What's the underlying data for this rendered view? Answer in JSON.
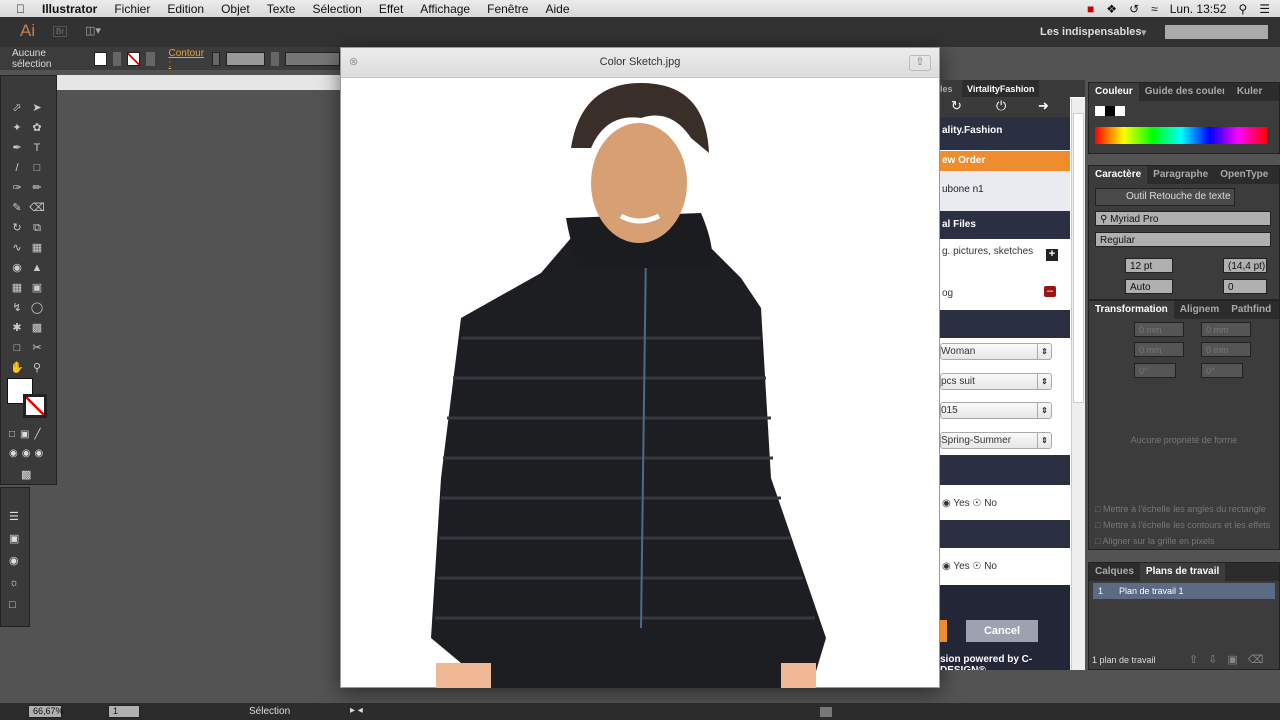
{
  "menubar": {
    "app": "Illustrator",
    "items": [
      "Fichier",
      "Edition",
      "Objet",
      "Texte",
      "Sélection",
      "Effet",
      "Affichage",
      "Fenêtre",
      "Aide"
    ],
    "clock": "Lun. 13:52"
  },
  "appbar": {
    "logo": "Ai",
    "bridge": "Br",
    "workspace": "Les indispensables",
    "search_placeholder": ""
  },
  "control": {
    "selection": "Aucune sélection",
    "stroke_label": "Contour :"
  },
  "quicklook": {
    "title": "Color Sketch.jpg"
  },
  "extension": {
    "tabs": [
      "les",
      "VirtalityFashion"
    ],
    "brand": "ality.Fashion",
    "new_order": "ew Order",
    "product": "ubone n1",
    "files_header": "al Files",
    "files_hint": "g. pictures, sketches",
    "file_name": "og",
    "selects": [
      "Woman",
      "pcs suit",
      "015",
      "Spring-Summer"
    ],
    "yes": "Yes",
    "no": "No",
    "cancel": "Cancel",
    "footer": "sion powered by C-DESIGN®."
  },
  "color_panel": {
    "tabs": [
      "Couleur",
      "Guide des couleı",
      "Kuler"
    ]
  },
  "char_panel": {
    "tabs": [
      "Caractère",
      "Paragraphe",
      "OpenType"
    ],
    "touch_tool": "Outil Retouche de texte",
    "font": "Myriad Pro",
    "style": "Regular",
    "size": "12 pt",
    "leading": "(14,4 pt)",
    "kerning": "Auto",
    "tracking": "0"
  },
  "transform_panel": {
    "tabs": [
      "Transformation",
      "Alignem",
      "Pathfind"
    ],
    "x": "0 mm",
    "y": "0 mm",
    "w": "0 mm",
    "h": "0 mm",
    "angle": "0°",
    "shear": "0°",
    "no_shape": "Aucune propriété de forme",
    "options": [
      "Mettre à l'échelle les angles du rectangle",
      "Mettre à l'échelle les contours et les effets",
      "Aligner sur la grille en pixels"
    ]
  },
  "artboards_panel": {
    "tabs": [
      "Calques",
      "Plans de travail"
    ],
    "rows": [
      {
        "num": "1",
        "name": "Plan de travail 1"
      }
    ],
    "count": "1 plan de travail"
  },
  "status": {
    "zoom": "66,67%",
    "artboard": "1",
    "tool": "Sélection"
  }
}
